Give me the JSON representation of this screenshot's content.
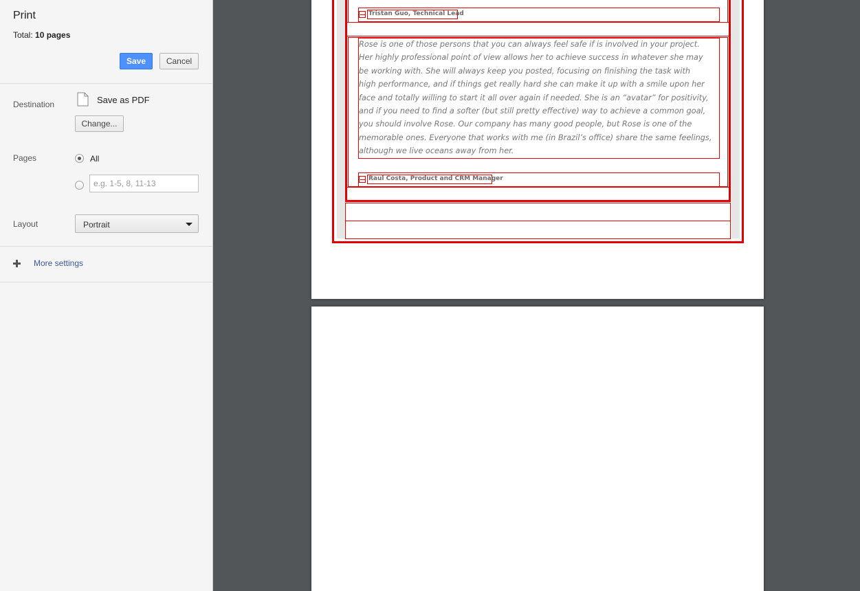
{
  "window": {
    "title": "Print"
  },
  "summary": {
    "total_label": "Total:",
    "total_value": "10 pages"
  },
  "buttons": {
    "save": "Save",
    "cancel": "Cancel",
    "change": "Change..."
  },
  "destination": {
    "label": "Destination",
    "name": "Save as PDF",
    "icon": "document-icon"
  },
  "pages": {
    "label": "Pages",
    "all_label": "All",
    "selected": "All",
    "range_placeholder": "e.g. 1-5, 8, 11-13",
    "range_value": ""
  },
  "layout": {
    "label": "Layout",
    "value": "Portrait"
  },
  "more_settings": {
    "label": "More settings",
    "icon": "plus-icon"
  },
  "preview": {
    "author_1": "Tristan Guo, Technical Lead",
    "quote_lines": [
      "Rose is one of those persons that you can always feel safe if is involved in your project.",
      "Her highly professional point of view allows her to achieve success in whatever she may",
      "be working with. She will always keep you posted, focusing on finishing the task with",
      "high performance, and if things get really hard she can make it up with a smile upon her",
      "face and totally willing to start it all over again if needed. She is an “avatar” for positivity,",
      "and if you need to find a softer (but still pretty effective) way to achieve a common goal,",
      "you should involve Rose. Our company has many good people, but Rose is one of the",
      "memorable ones. Everyone that works with me (in Brazil’s office) share the same feelings,",
      "although we live oceans away from her."
    ],
    "author_2": "Raul Costa, Product and CRM Manager"
  },
  "colors": {
    "accent": "#4d90fe",
    "outline": "#e00000",
    "preview_bg": "#525659",
    "link": "#3b5998"
  }
}
